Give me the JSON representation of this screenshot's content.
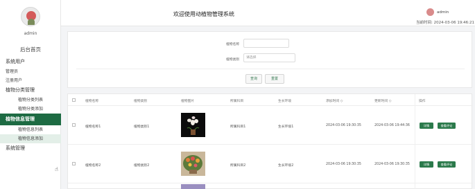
{
  "sidebar": {
    "username": "admin",
    "nav": [
      {
        "label": "后台首页"
      },
      {
        "label": "系统用户"
      },
      {
        "label": "管理员"
      },
      {
        "label": "注册用户"
      },
      {
        "label": "植物分类管理"
      },
      {
        "label": "植物分类列表"
      },
      {
        "label": "植物分类添加"
      },
      {
        "label": "植物信息管理"
      },
      {
        "label": "植物信息列表"
      },
      {
        "label": "植物信息添加"
      },
      {
        "label": "系统管理"
      }
    ]
  },
  "header": {
    "title": "欢迎使用动植物管理系统",
    "user": "admin",
    "time_label": "当前时间:",
    "time_value": "2024-03-06 19:46:21"
  },
  "search": {
    "name_label": "植物名称",
    "name_value": "",
    "type_label": "植物类别",
    "type_placeholder": "请选择",
    "query_button": "查询",
    "reset_button": "重置"
  },
  "table": {
    "headers": [
      "植物名称",
      "植物类别",
      "植物图片",
      "所属科目",
      "生长环境",
      "添加时间 ◇",
      "更新时间 ◇",
      "操作"
    ],
    "rows": [
      {
        "name": "植物名称1",
        "type": "植物类别1",
        "family": "所属科目1",
        "env": "生长环境1",
        "created": "2024-03-06 19:30:35",
        "updated": "2024-03-06 19:44:36",
        "btn1": "详情",
        "btn2": "查看评论"
      },
      {
        "name": "植物名称2",
        "type": "植物类别2",
        "family": "所属科目2",
        "env": "生长环境2",
        "created": "2024-03-06 19:30:35",
        "updated": "2024-03-06 19:30:35",
        "btn1": "详情",
        "btn2": "查看评论"
      }
    ]
  },
  "colors": {
    "accent": "#1d6b43",
    "button": "#2b7a4b"
  }
}
